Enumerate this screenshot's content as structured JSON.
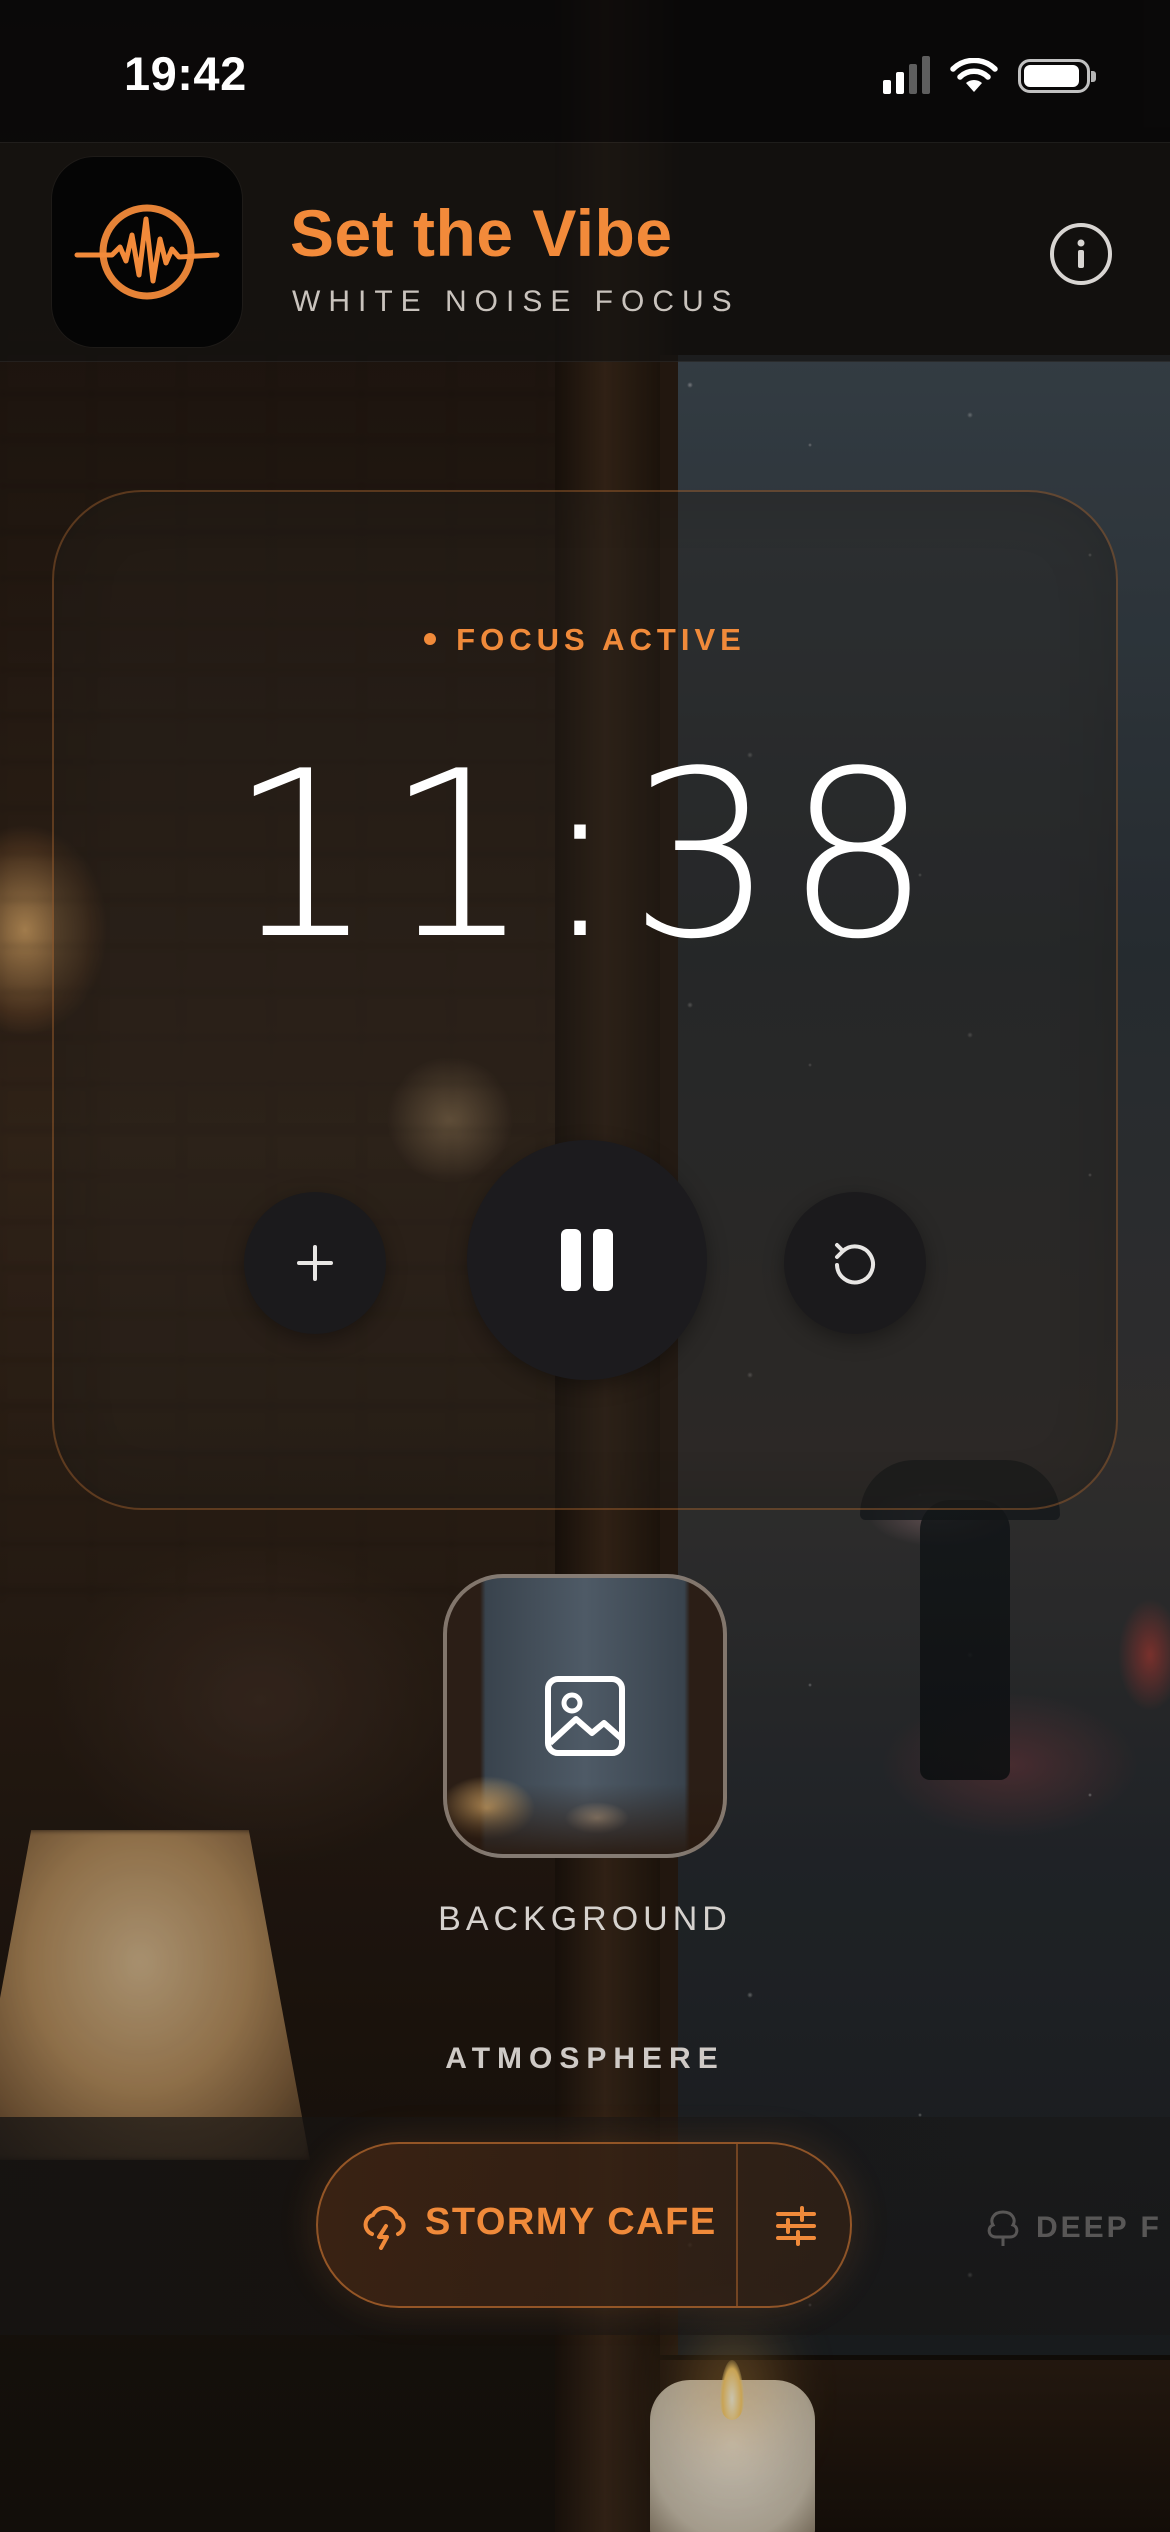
{
  "status_bar": {
    "time": "19:42"
  },
  "header": {
    "title": "Set the Vibe",
    "subtitle": "WHITE NOISE FOCUS",
    "logo_icon": "waveform-ring-icon",
    "info_icon": "info-icon"
  },
  "timer": {
    "status": "FOCUS ACTIVE",
    "time": "11:38",
    "controls": {
      "add_icon": "plus-icon",
      "pause_icon": "pause-icon",
      "reset_icon": "reset-icon"
    }
  },
  "background_picker": {
    "label": "BACKGROUND",
    "icon": "image-icon"
  },
  "atmosphere": {
    "section_label": "ATMOSPHERE",
    "selected": "STORMY CAFE",
    "selected_icon": "storm-cloud-icon",
    "settings_icon": "sliders-icon",
    "next": "DEEP F",
    "next_icon": "tree-icon"
  },
  "colors": {
    "accent": "#F28A3A",
    "surface": "#1B1A1C"
  }
}
